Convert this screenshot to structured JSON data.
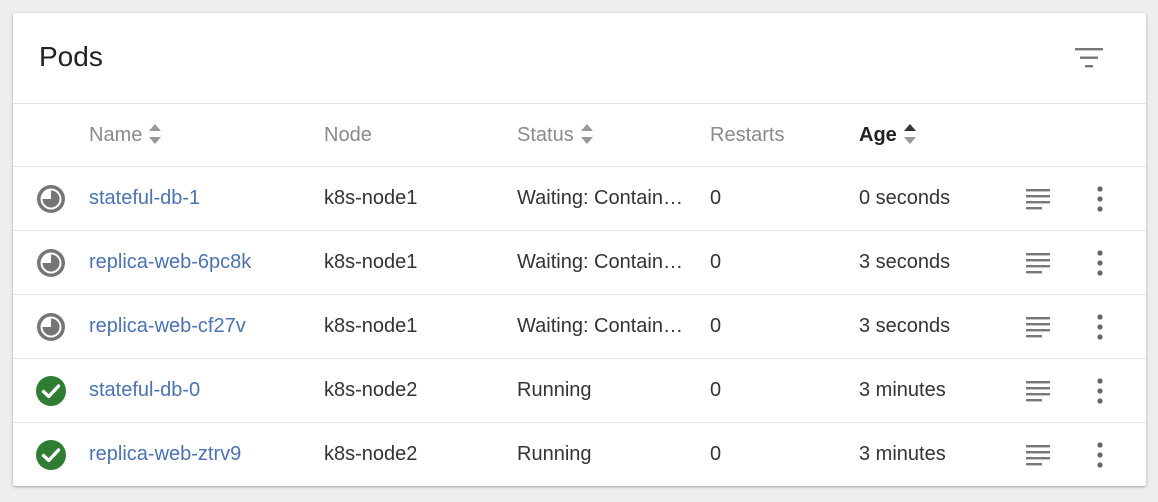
{
  "card": {
    "title": "Pods"
  },
  "table": {
    "headers": {
      "name": "Name",
      "node": "Node",
      "status": "Status",
      "restarts": "Restarts",
      "age": "Age"
    },
    "rows": [
      {
        "status_icon": "pending-icon",
        "name": "stateful-db-1",
        "node": "k8s-node1",
        "status": "Waiting: ContainerCreating",
        "restarts": "0",
        "age": "0 seconds"
      },
      {
        "status_icon": "pending-icon",
        "name": "replica-web-6pc8k",
        "node": "k8s-node1",
        "status": "Waiting: ContainerCreating",
        "restarts": "0",
        "age": "3 seconds"
      },
      {
        "status_icon": "pending-icon",
        "name": "replica-web-cf27v",
        "node": "k8s-node1",
        "status": "Waiting: ContainerCreating",
        "restarts": "0",
        "age": "3 seconds"
      },
      {
        "status_icon": "check-circle-icon",
        "name": "stateful-db-0",
        "node": "k8s-node2",
        "status": "Running",
        "restarts": "0",
        "age": "3 minutes"
      },
      {
        "status_icon": "check-circle-icon",
        "name": "replica-web-ztrv9",
        "node": "k8s-node2",
        "status": "Running",
        "restarts": "0",
        "age": "3 minutes"
      }
    ]
  },
  "colors": {
    "link": "#4a72b5",
    "success": "#2e7d32",
    "pending": "#757575"
  }
}
